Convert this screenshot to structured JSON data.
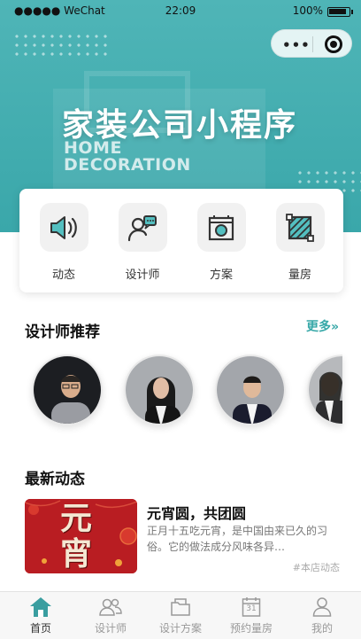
{
  "status_bar": {
    "carrier": "●●●●● WeChat",
    "time": "22:09",
    "battery": "100%"
  },
  "capsule": {
    "more": "•••"
  },
  "banner": {
    "title": "家装公司小程序",
    "subtitle_line1": "HOME",
    "subtitle_line2": "DECORATION"
  },
  "menu": [
    {
      "label": "动态",
      "icon": "speaker-icon"
    },
    {
      "label": "设计师",
      "icon": "designer-chat-icon"
    },
    {
      "label": "方案",
      "icon": "plan-icon"
    },
    {
      "label": "量房",
      "icon": "measure-icon"
    }
  ],
  "designers": {
    "title": "设计师推荐",
    "more": "更多»"
  },
  "news": {
    "title": "最新动态",
    "item_title": "元宵圆，共团圆",
    "item_desc": "正月十五吃元宵，是中国由来已久的习俗。它的做法成分风味各异…",
    "item_tag": "#本店动态",
    "image_text": "元宵"
  },
  "tabbar": [
    {
      "label": "首页",
      "icon": "home-icon",
      "active": true
    },
    {
      "label": "设计师",
      "icon": "people-icon",
      "active": false
    },
    {
      "label": "设计方案",
      "icon": "folder-icon",
      "active": false
    },
    {
      "label": "预约量房",
      "icon": "calendar-icon",
      "active": false,
      "badge": "31"
    },
    {
      "label": "我的",
      "icon": "user-icon",
      "active": false
    }
  ],
  "colors": {
    "accent": "#37a8a8",
    "banner": "#44aeb0"
  }
}
